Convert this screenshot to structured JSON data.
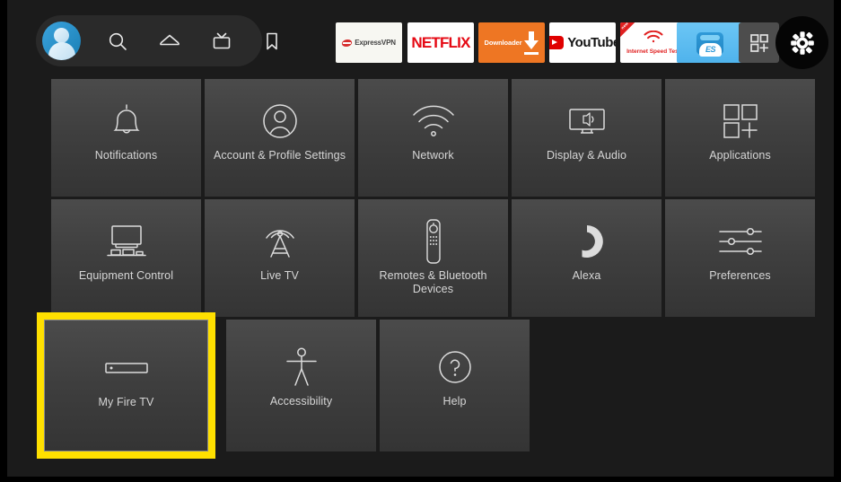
{
  "topbar": {
    "nav": [
      {
        "name": "profile-avatar",
        "label": "Profile"
      },
      {
        "name": "search-icon",
        "label": "Search"
      },
      {
        "name": "home-icon",
        "label": "Home"
      },
      {
        "name": "live-tv-icon",
        "label": "Live TV"
      },
      {
        "name": "bookmark-icon",
        "label": "Your Stuff"
      }
    ],
    "apps": [
      {
        "name": "app-expressvpn",
        "label": "ExpressVPN",
        "bg": "#f7f7f2"
      },
      {
        "name": "app-netflix",
        "label": "NETFLIX",
        "bg": "#ffffff"
      },
      {
        "name": "app-downloader",
        "label": "Downloader",
        "bg": "#ee7623"
      },
      {
        "name": "app-youtube",
        "label": "YouTube",
        "bg": "#ffffff"
      },
      {
        "name": "app-internet-speed-test",
        "label": "Internet Speed Test",
        "badge": "new",
        "bg": "#ffffff"
      },
      {
        "name": "app-es-file-explorer",
        "label": "ES",
        "bg": "#4fb3ec"
      }
    ],
    "apps_grid_label": "Apps",
    "settings_gear_label": "Settings"
  },
  "grid": {
    "tiles": [
      {
        "name": "settings-tile-notifications",
        "label": "Notifications",
        "icon": "bell-icon"
      },
      {
        "name": "settings-tile-account-profile-settings",
        "label": "Account & Profile Settings",
        "icon": "person-circle-icon"
      },
      {
        "name": "settings-tile-network",
        "label": "Network",
        "icon": "wifi-icon"
      },
      {
        "name": "settings-tile-display-audio",
        "label": "Display & Audio",
        "icon": "tv-speaker-icon"
      },
      {
        "name": "settings-tile-applications",
        "label": "Applications",
        "icon": "apps-grid-icon"
      },
      {
        "name": "settings-tile-equipment-control",
        "label": "Equipment Control",
        "icon": "tv-equipment-icon"
      },
      {
        "name": "settings-tile-live-tv",
        "label": "Live TV",
        "icon": "antenna-icon"
      },
      {
        "name": "settings-tile-remotes-bluetooth-devices",
        "label": "Remotes & Bluetooth Devices",
        "icon": "remote-icon"
      },
      {
        "name": "settings-tile-alexa",
        "label": "Alexa",
        "icon": "alexa-ring-icon"
      },
      {
        "name": "settings-tile-preferences",
        "label": "Preferences",
        "icon": "sliders-icon"
      },
      {
        "name": "settings-tile-my-fire-tv",
        "label": "My Fire TV",
        "icon": "fire-tv-stick-icon",
        "selected": true
      },
      {
        "name": "settings-tile-accessibility",
        "label": "Accessibility",
        "icon": "accessibility-icon"
      },
      {
        "name": "settings-tile-help",
        "label": "Help",
        "icon": "question-circle-icon"
      }
    ]
  },
  "colors": {
    "selection": "#ffe000",
    "page_background": "#1b1b1b",
    "tile_top": "#4b4b4b",
    "tile_bottom": "#343434",
    "label": "#d6d6d6",
    "netflix_red": "#e50914",
    "downloader_orange": "#ee7623",
    "speedtest_red": "#e02020",
    "es_blue": "#4fb3ec",
    "avatar_blue": "#1a7fb5"
  }
}
